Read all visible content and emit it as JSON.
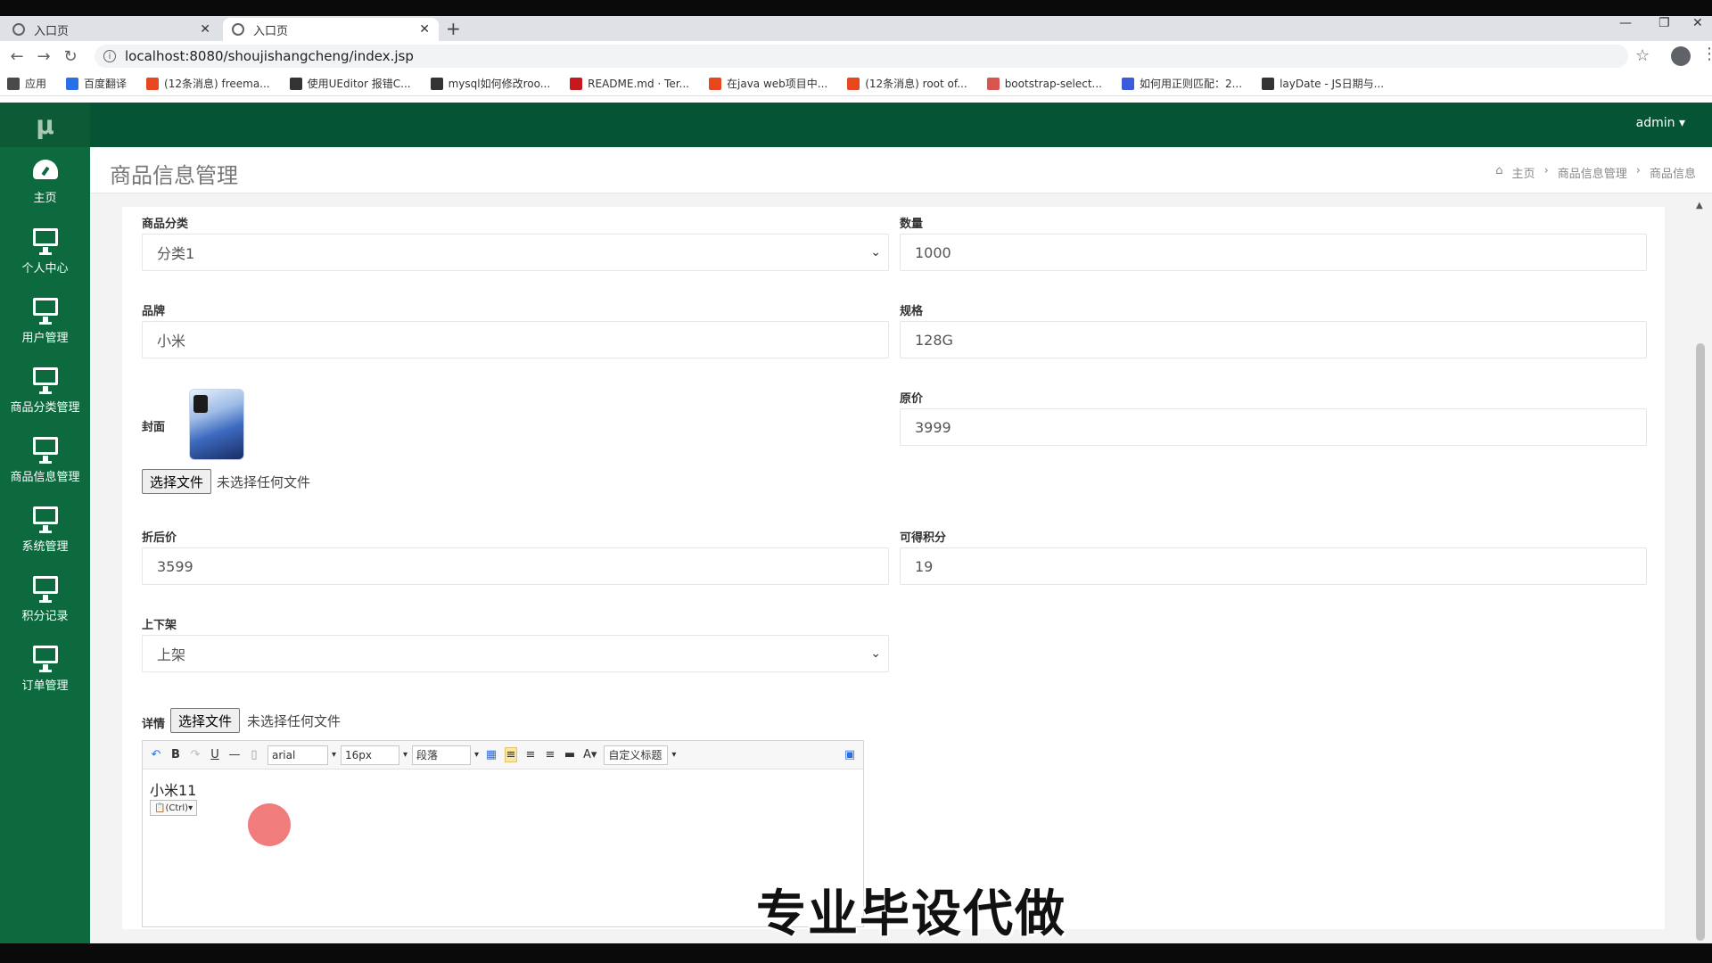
{
  "browser": {
    "tabs": [
      {
        "label": "入口页",
        "active": false
      },
      {
        "label": "入口页",
        "active": true
      }
    ],
    "url": "localhost:8080/shoujishangcheng/index.jsp",
    "bookmarks": [
      {
        "label": "应用",
        "color": "#4a4a4a"
      },
      {
        "label": "百度翻译",
        "color": "#2a6ee8"
      },
      {
        "label": "(12条消息) freema...",
        "color": "#e8461f"
      },
      {
        "label": "使用UEditor 报错C...",
        "color": "#333333"
      },
      {
        "label": "mysql如何修改roo...",
        "color": "#333333"
      },
      {
        "label": "README.md · Ter...",
        "color": "#c7181d"
      },
      {
        "label": "在java web项目中...",
        "color": "#e8461f"
      },
      {
        "label": "(12条消息) root of...",
        "color": "#e8461f"
      },
      {
        "label": "bootstrap-select...",
        "color": "#d9534f"
      },
      {
        "label": "如何用正则匹配：2...",
        "color": "#3b5bdb"
      },
      {
        "label": "layDate - JS日期与...",
        "color": "#333333"
      }
    ]
  },
  "app": {
    "logo": "μ",
    "user": "admin",
    "sidebar": [
      {
        "label": "主页",
        "icon": "dashboard-icon"
      },
      {
        "label": "个人中心",
        "icon": "monitor-icon"
      },
      {
        "label": "用户管理",
        "icon": "monitor-icon"
      },
      {
        "label": "商品分类管理",
        "icon": "monitor-icon"
      },
      {
        "label": "商品信息管理",
        "icon": "monitor-icon"
      },
      {
        "label": "系统管理",
        "icon": "monitor-icon"
      },
      {
        "label": "积分记录",
        "icon": "monitor-icon"
      },
      {
        "label": "订单管理",
        "icon": "monitor-icon"
      }
    ],
    "page_title": "商品信息管理",
    "breadcrumb": [
      "主页",
      "商品信息管理",
      "商品信息"
    ]
  },
  "form": {
    "category_label": "商品分类",
    "category_value": "分类1",
    "quantity_label": "数量",
    "quantity_value": "1000",
    "brand_label": "品牌",
    "brand_value": "小米",
    "spec_label": "规格",
    "spec_value": "128G",
    "cover_label": "封面",
    "original_price_label": "原价",
    "original_price_value": "3999",
    "choose_file": "选择文件",
    "no_file": "未选择任何文件",
    "discount_price_label": "折后价",
    "discount_price_value": "3599",
    "points_label": "可得积分",
    "points_value": "19",
    "shelf_label": "上下架",
    "shelf_value": "上架",
    "detail_label": "详情",
    "editor": {
      "font": "arial",
      "size": "16px",
      "paragraph": "段落",
      "custom_title": "自定义标题",
      "content": "小米11",
      "paste_hint": "(Ctrl)"
    }
  },
  "overlay_text": "专业毕设代做"
}
